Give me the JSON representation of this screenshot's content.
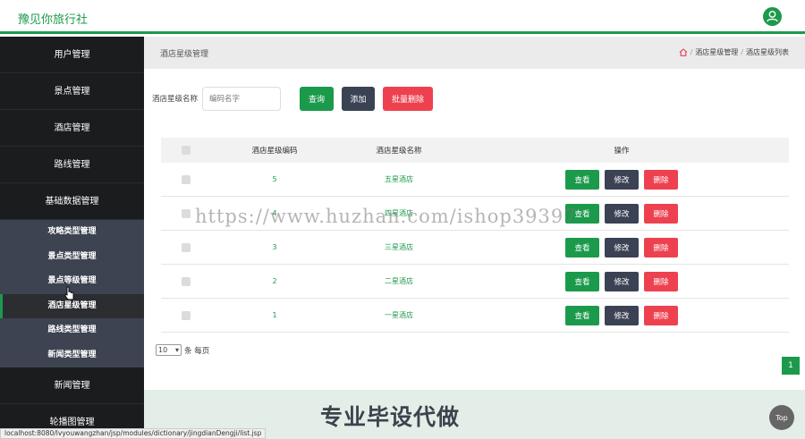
{
  "header": {
    "brand": "豫见你旅行社",
    "user_icon": "user-icon"
  },
  "sidebar": {
    "items_top": [
      "用户管理",
      "景点管理",
      "酒店管理",
      "路线管理",
      "基础数据管理"
    ],
    "submenu": [
      "攻略类型管理",
      "景点类型管理",
      "景点等级管理",
      "酒店星级管理",
      "路线类型管理",
      "新闻类型管理"
    ],
    "active_sub": 3,
    "items_bottom": [
      "新闻管理",
      "轮播图管理"
    ]
  },
  "breadcrumb": {
    "title": "酒店星级管理",
    "home_icon": "home-icon",
    "level1": "酒店星级管理",
    "level2": "酒店星级列表",
    "sep": "/"
  },
  "search": {
    "label": "酒店星级名称",
    "placeholder": "编码名字",
    "query": "查询",
    "add": "添加",
    "batch_delete": "批量删除"
  },
  "table": {
    "headers": {
      "code": "酒店星级编码",
      "name": "酒店星级名称",
      "ops": "操作"
    },
    "rows": [
      {
        "code": "5",
        "name": "五星酒店"
      },
      {
        "code": "4",
        "name": "四星酒店"
      },
      {
        "code": "3",
        "name": "三星酒店"
      },
      {
        "code": "2",
        "name": "二星酒店"
      },
      {
        "code": "1",
        "name": "一星酒店"
      }
    ],
    "ops": {
      "view": "查看",
      "edit": "修改",
      "delete": "删除"
    }
  },
  "pagination": {
    "page_size": "10",
    "suffix": "条 每页",
    "current": "1"
  },
  "footer": {
    "text": "专业毕设代做",
    "top": "Top"
  },
  "status_url": "localhost:8080/lvyouwangzhan/jsp/modules/dictionary/jingdianDengji/list.jsp",
  "watermark": "https://www.huzhan.com/ishop39397",
  "colors": {
    "accent": "#1c9a4c",
    "dark": "#3b4254",
    "danger": "#ee4150"
  }
}
